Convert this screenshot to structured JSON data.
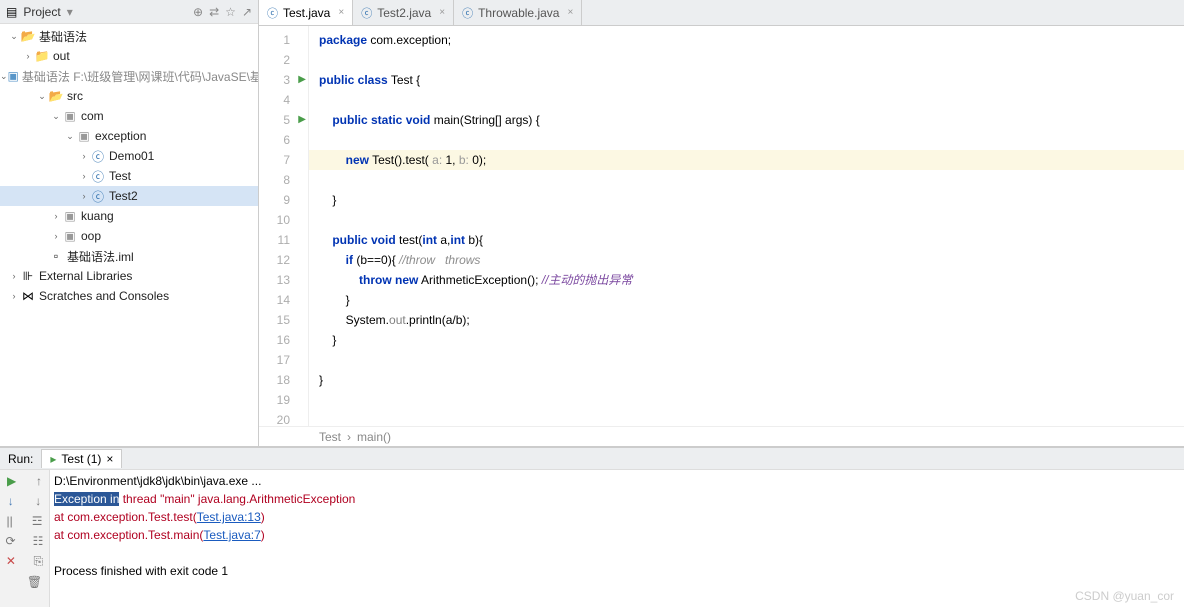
{
  "project": {
    "title": "Project",
    "toolbar_icons": [
      "⊕",
      "⇄",
      "☆",
      "↗"
    ],
    "tree": [
      {
        "depth": 0,
        "chev": "v",
        "icon": "folder-open",
        "label": "基础语法",
        "cls": ""
      },
      {
        "depth": 1,
        "chev": ">",
        "icon": "folder",
        "label": "out",
        "cls": ""
      },
      {
        "depth": 1,
        "chev": "v",
        "icon": "mod",
        "label": "基础语法 F:\\班级管理\\网课班\\代码\\JavaSE\\基",
        "cls": "dim"
      },
      {
        "depth": 2,
        "chev": "v",
        "icon": "folder-open",
        "label": "src",
        "cls": ""
      },
      {
        "depth": 3,
        "chev": "v",
        "icon": "pkg",
        "label": "com",
        "cls": ""
      },
      {
        "depth": 4,
        "chev": "v",
        "icon": "pkg",
        "label": "exception",
        "cls": ""
      },
      {
        "depth": 5,
        "chev": ">",
        "icon": "jfile",
        "label": "Demo01",
        "cls": ""
      },
      {
        "depth": 5,
        "chev": ">",
        "icon": "jfile",
        "label": "Test",
        "cls": ""
      },
      {
        "depth": 5,
        "chev": ">",
        "icon": "jfile",
        "label": "Test2",
        "cls": "",
        "selected": true
      },
      {
        "depth": 3,
        "chev": ">",
        "icon": "pkg",
        "label": "kuang",
        "cls": ""
      },
      {
        "depth": 3,
        "chev": ">",
        "icon": "pkg",
        "label": "oop",
        "cls": ""
      },
      {
        "depth": 2,
        "chev": "",
        "icon": "file",
        "label": "基础语法.iml",
        "cls": ""
      },
      {
        "depth": 0,
        "chev": ">",
        "icon": "lib",
        "label": "External Libraries",
        "cls": ""
      },
      {
        "depth": 0,
        "chev": ">",
        "icon": "scratch",
        "label": "Scratches and Consoles",
        "cls": ""
      }
    ]
  },
  "tabs": [
    {
      "label": "Test.java",
      "active": true
    },
    {
      "label": "Test2.java",
      "active": false
    },
    {
      "label": "Throwable.java",
      "active": false
    }
  ],
  "editor": {
    "lines": [
      {
        "n": 1,
        "html": "<span class='kw'>package</span> com.exception;"
      },
      {
        "n": 2,
        "html": ""
      },
      {
        "n": 3,
        "html": "<span class='kw'>public class</span> Test {",
        "mark": true
      },
      {
        "n": 4,
        "html": ""
      },
      {
        "n": 5,
        "html": "    <span class='kw'>public static void</span> main(String[] args) {",
        "mark": true
      },
      {
        "n": 6,
        "html": ""
      },
      {
        "n": 7,
        "html": "        <span class='kw'>new</span> Test().test( <span class='hint'>a:</span> 1, <span class='hint'>b:</span> 0);",
        "hl": true
      },
      {
        "n": 8,
        "html": ""
      },
      {
        "n": 9,
        "html": "    }"
      },
      {
        "n": 10,
        "html": ""
      },
      {
        "n": 11,
        "html": "    <span class='kw'>public void</span> test(<span class='kw'>int</span> a,<span class='kw'>int</span> b){"
      },
      {
        "n": 12,
        "html": "        <span class='kw'>if</span> (b==0){ <span class='com'>//throw   throws</span>"
      },
      {
        "n": 13,
        "html": "            <span class='kw'>throw new</span> ArithmeticException(); <span class='com2'>//主动的抛出异常</span>"
      },
      {
        "n": 14,
        "html": "        }"
      },
      {
        "n": 15,
        "html": "        System.<span class='ann'>out</span>.println(a/b);"
      },
      {
        "n": 16,
        "html": "    }"
      },
      {
        "n": 17,
        "html": ""
      },
      {
        "n": 18,
        "html": "}"
      },
      {
        "n": 19,
        "html": ""
      },
      {
        "n": 20,
        "html": ""
      }
    ],
    "breadcrumb": [
      "Test",
      "main()"
    ]
  },
  "run": {
    "label": "Run:",
    "tab": "Test (1)",
    "tools_left": [
      "▶",
      "↓",
      "||",
      "⟳",
      "✕"
    ],
    "tools_right": [
      "↑",
      "↓",
      "☲",
      "☷",
      "⎘",
      "🗑"
    ],
    "lines": [
      {
        "html": "D:\\Environment\\jdk8\\jdk\\bin\\java.exe ...<span class='invsel'> </span>"
      },
      {
        "html": "<span class='invsel'>Exception in</span><span class='err'> thread \"main\" java.lang.ArithmeticException</span>"
      },
      {
        "html": "<span class='err'>    at com.exception.Test.test(</span><span class='lnk'>Test.java:13</span><span class='err'>)</span>"
      },
      {
        "html": "<span class='err'>    at com.exception.Test.main(</span><span class='lnk'>Test.java:7</span><span class='err'>)</span>"
      },
      {
        "html": ""
      },
      {
        "html": "Process finished with exit code 1"
      }
    ]
  },
  "watermark": "CSDN @yuan_cor"
}
